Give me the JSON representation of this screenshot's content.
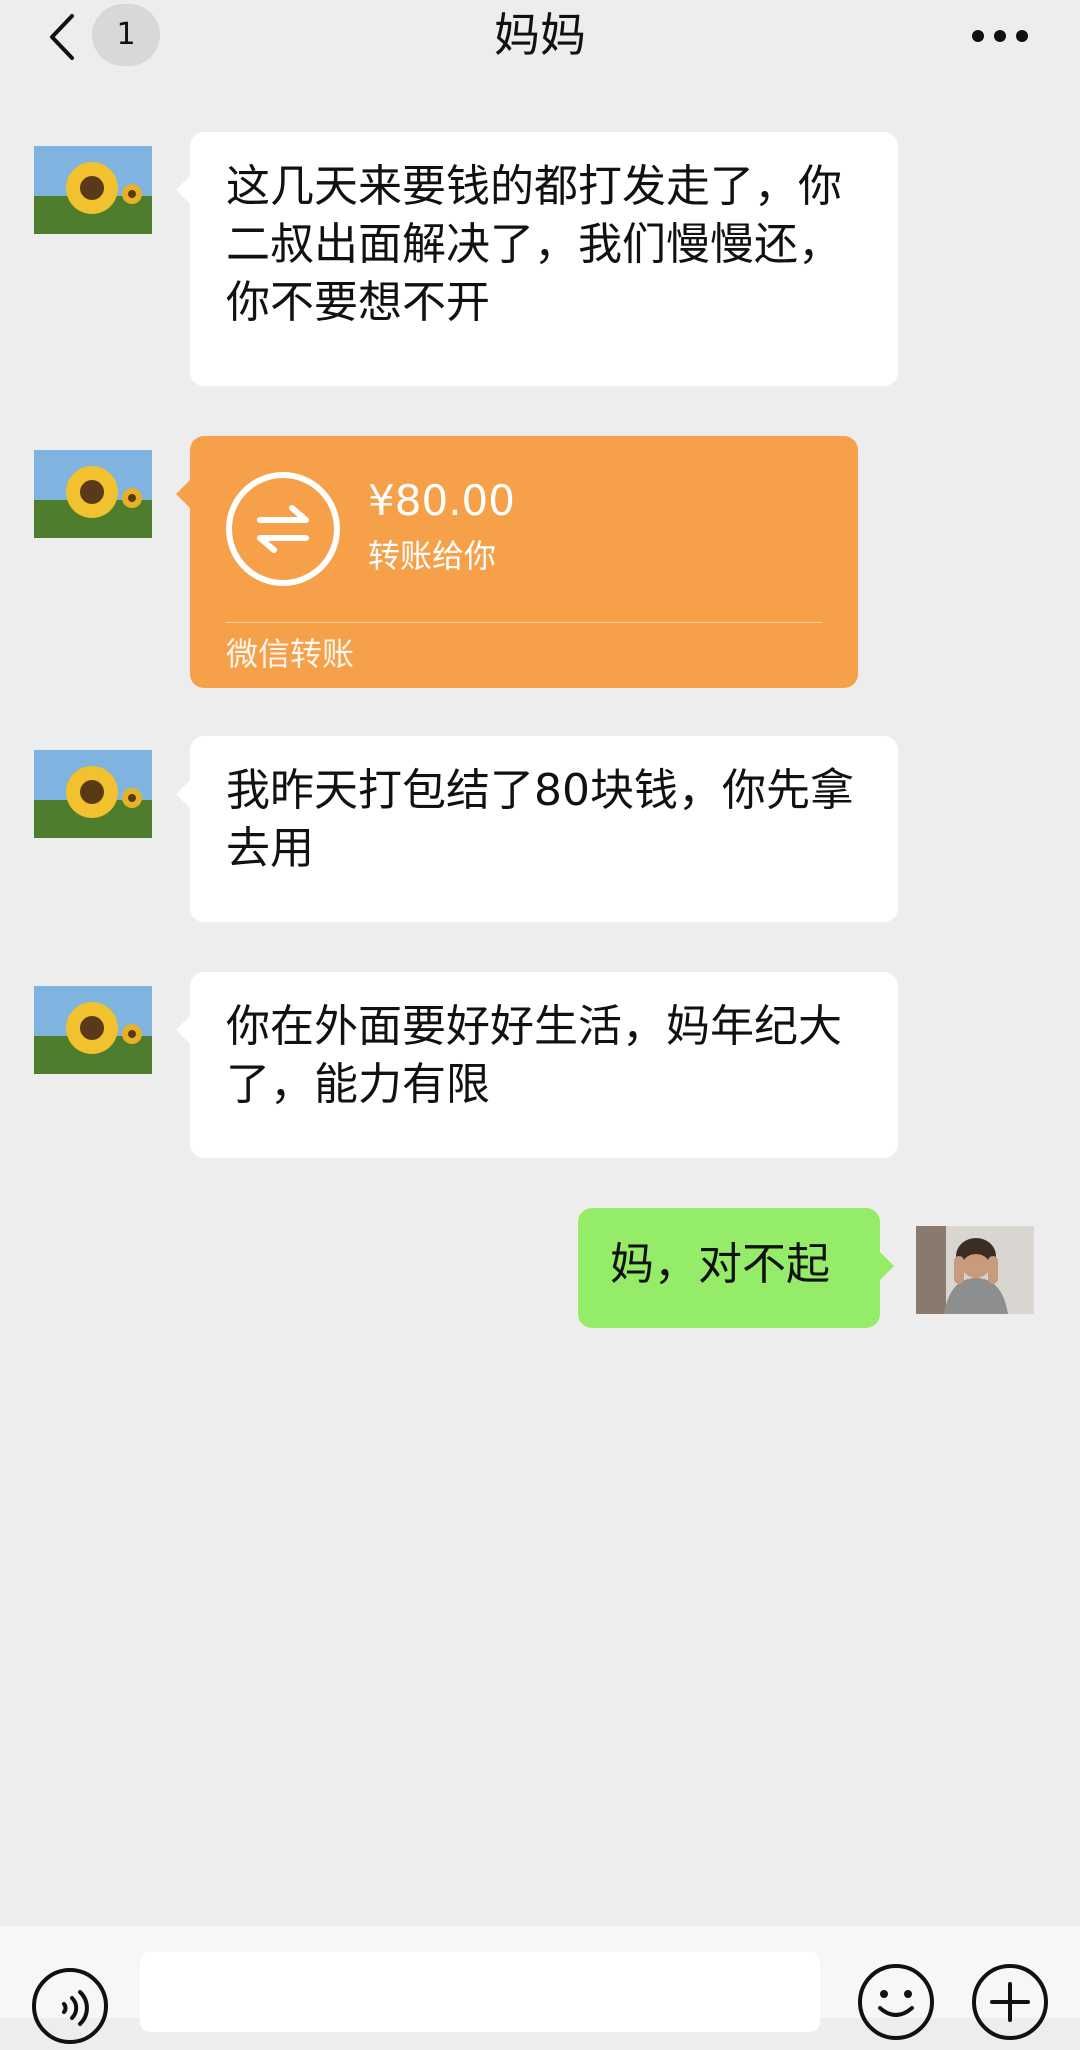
{
  "header": {
    "back_icon": "chevron-left-icon",
    "unread_count": "1",
    "title": "妈妈",
    "more_icon": "more-dots-icon"
  },
  "messages": [
    {
      "sender": "contact",
      "avatar": "sunflower-avatar",
      "text": "这几天来要钱的都打发走了，你二叔出面解决了，我们慢慢还，你不要想不开"
    },
    {
      "sender": "contact",
      "avatar": "sunflower-avatar",
      "type": "transfer",
      "amount": "¥80.00",
      "note": "转账给你",
      "label": "微信转账"
    },
    {
      "sender": "contact",
      "avatar": "sunflower-avatar",
      "text": "我昨天打包结了80块钱，你先拿去用"
    },
    {
      "sender": "contact",
      "avatar": "sunflower-avatar",
      "text": "你在外面要好好生活，妈年纪大了，能力有限"
    },
    {
      "sender": "me",
      "avatar": "user-avatar",
      "text": "妈，对不起"
    }
  ],
  "input_bar": {
    "voice_icon": "voice-icon",
    "emoji_icon": "emoji-icon",
    "plus_icon": "plus-icon"
  },
  "colors": {
    "background": "#ededed",
    "incoming_bubble": "#ffffff",
    "outgoing_bubble": "#95ec69",
    "transfer_card": "#f6a04a"
  }
}
